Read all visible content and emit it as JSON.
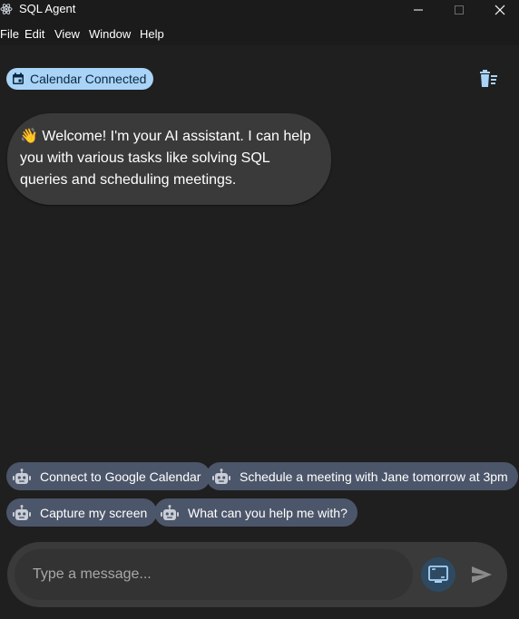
{
  "window": {
    "title": "SQL Agent",
    "icons": {
      "app": "electron-icon",
      "minimize": "minimize-icon",
      "maximize": "maximize-icon",
      "close": "close-icon"
    }
  },
  "menubar": {
    "items": [
      "File",
      "Edit",
      "View",
      "Window",
      "Help"
    ]
  },
  "header": {
    "status_badge": {
      "label": "Calendar Connected",
      "icon": "calendar-icon",
      "color": "#a9d3f7"
    },
    "clear_icon": "clear-chat-icon"
  },
  "messages": [
    {
      "role": "assistant",
      "emoji": "👋",
      "text": "Welcome! I'm your AI assistant. I can help you with various tasks like solving SQL queries and scheduling meetings."
    }
  ],
  "suggestions": [
    {
      "label": "Connect to Google Calendar",
      "icon": "robot-icon"
    },
    {
      "label": "Schedule a meeting with Jane tomorrow at 3pm",
      "icon": "robot-icon"
    },
    {
      "label": "Capture my screen",
      "icon": "robot-icon"
    },
    {
      "label": "What can you help me with?",
      "icon": "robot-icon"
    }
  ],
  "composer": {
    "placeholder": "Type a message...",
    "value": "",
    "capture_icon": "screen-capture-icon",
    "send_icon": "send-icon"
  },
  "colors": {
    "background": "#1f1f1f",
    "bubble": "#3a3a3a",
    "chip": "#4c566a",
    "accent": "#a9d3f7",
    "capture_button": "#2e4a63"
  }
}
